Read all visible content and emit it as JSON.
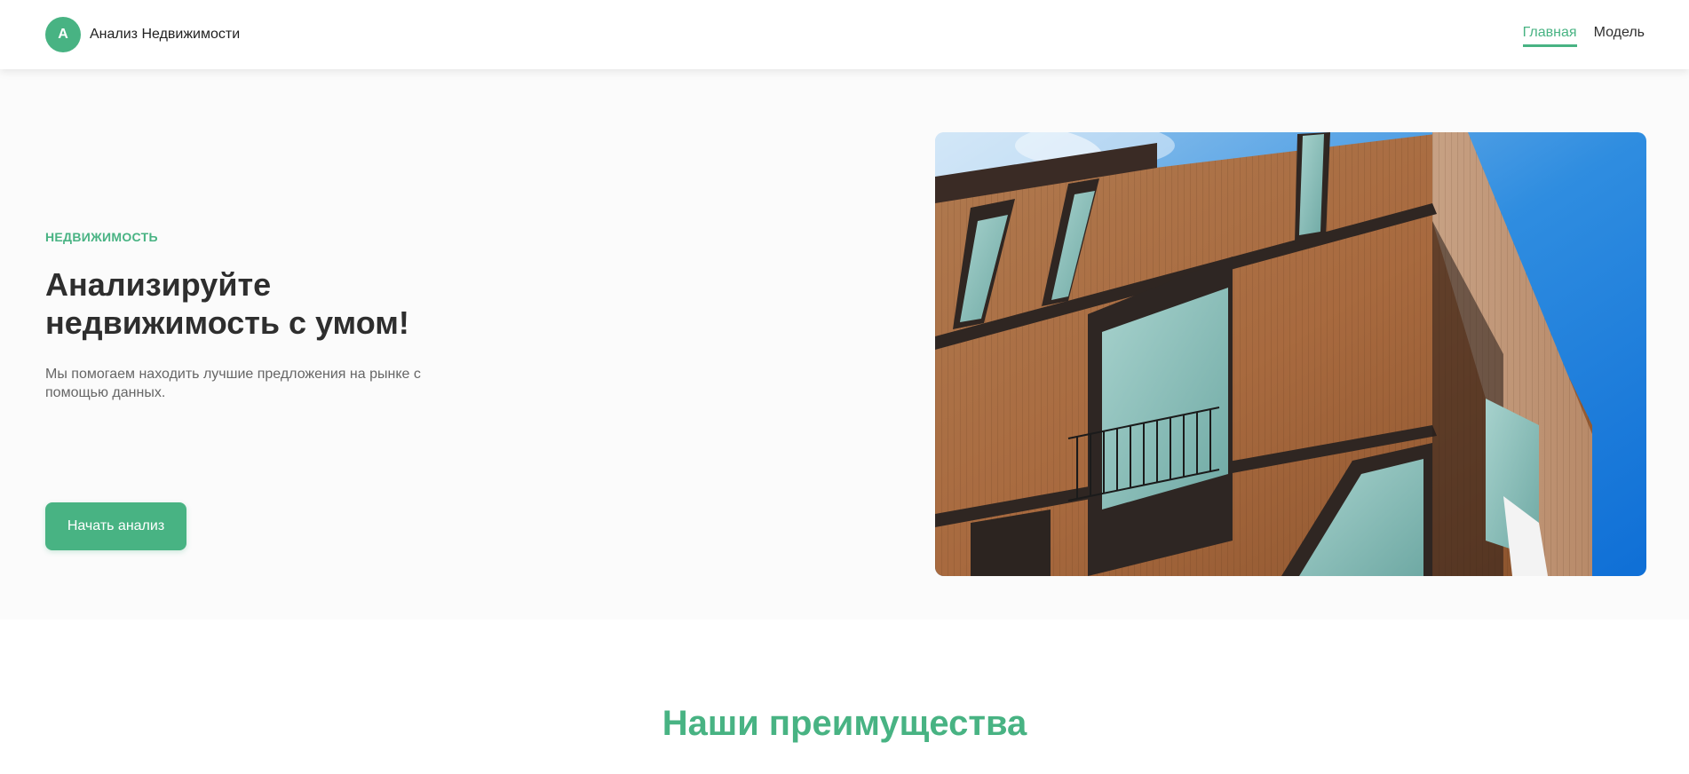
{
  "header": {
    "logo_letter": "А",
    "brand_name": "Анализ Недвижимости",
    "nav": [
      {
        "label": "Главная",
        "active": true
      },
      {
        "label": "Модель",
        "active": false
      }
    ]
  },
  "hero": {
    "eyebrow": "НЕДВИЖИМОСТЬ",
    "title": "Анализируйте недвижимость с умом!",
    "subtitle": "Мы помогаем находить лучшие предложения на рынке с помощью данных.",
    "cta_label": "Начать анализ",
    "image_icon": "building-photo"
  },
  "features": {
    "title": "Наши преимущества"
  },
  "colors": {
    "accent": "#48b383",
    "heading": "#2e2e2e",
    "muted": "#666666"
  }
}
